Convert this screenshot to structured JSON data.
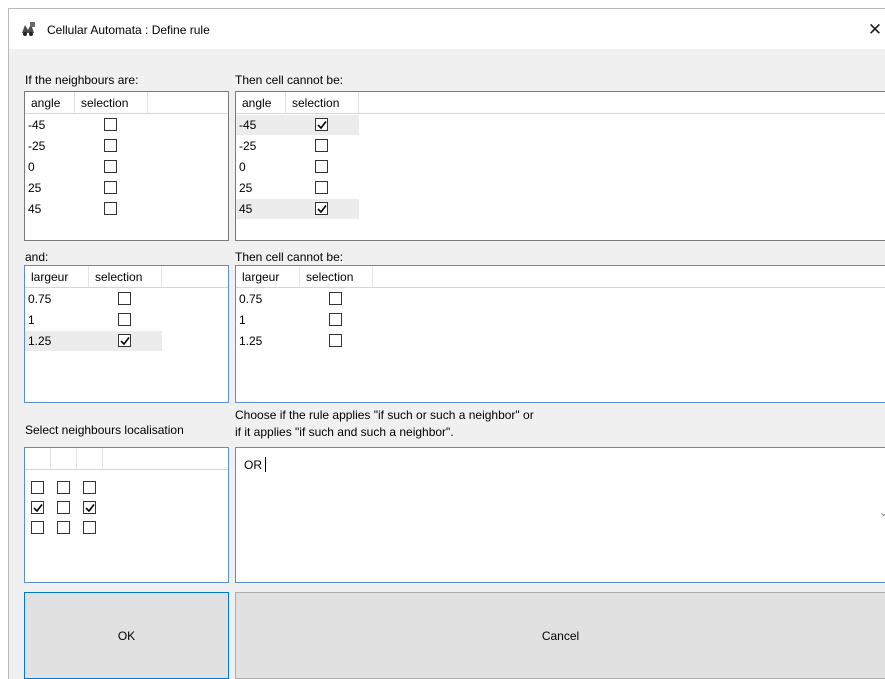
{
  "window": {
    "title": "Cellular Automata : Define rule",
    "close_glyph": "✕",
    "icon": "rhino-grasshopper-app-icon"
  },
  "angles_panel": {
    "label": "If the neighbours are:",
    "columns": [
      "angle",
      "selection"
    ],
    "rows": [
      {
        "value": "-45",
        "checked": false
      },
      {
        "value": "-25",
        "checked": false
      },
      {
        "value": "0",
        "checked": false
      },
      {
        "value": "25",
        "checked": false
      },
      {
        "value": "45",
        "checked": false
      }
    ]
  },
  "angles_result_panel": {
    "label": "Then cell cannot be:",
    "columns": [
      "angle",
      "selection"
    ],
    "rows": [
      {
        "value": "-45",
        "checked": true
      },
      {
        "value": "-25",
        "checked": false
      },
      {
        "value": "0",
        "checked": false
      },
      {
        "value": "25",
        "checked": false
      },
      {
        "value": "45",
        "checked": true
      }
    ]
  },
  "width_panel": {
    "label": "and:",
    "columns": [
      "largeur",
      "selection"
    ],
    "rows": [
      {
        "value": "0.75",
        "checked": false
      },
      {
        "value": "1",
        "checked": false
      },
      {
        "value": "1.25",
        "checked": true
      }
    ]
  },
  "width_result_panel": {
    "label": "Then cell cannot be:",
    "columns": [
      "largeur",
      "selection"
    ],
    "rows": [
      {
        "value": "0.75",
        "checked": false
      },
      {
        "value": "1",
        "checked": false
      },
      {
        "value": "1.25",
        "checked": false
      }
    ]
  },
  "neighbours_panel": {
    "label": "Select neighbours localisation",
    "grid": [
      [
        false,
        false,
        false
      ],
      [
        true,
        false,
        true
      ],
      [
        false,
        false,
        false
      ]
    ]
  },
  "rule_mode": {
    "label_line1": "Choose if the rule applies \"if such or such a neighbor\" or",
    "label_line2": " if it applies \"if such and such a neighbor\".",
    "value": "OR",
    "dropdown_icon": "chevron-down-icon"
  },
  "buttons": {
    "ok_label": "OK",
    "cancel_label": "Cancel"
  }
}
